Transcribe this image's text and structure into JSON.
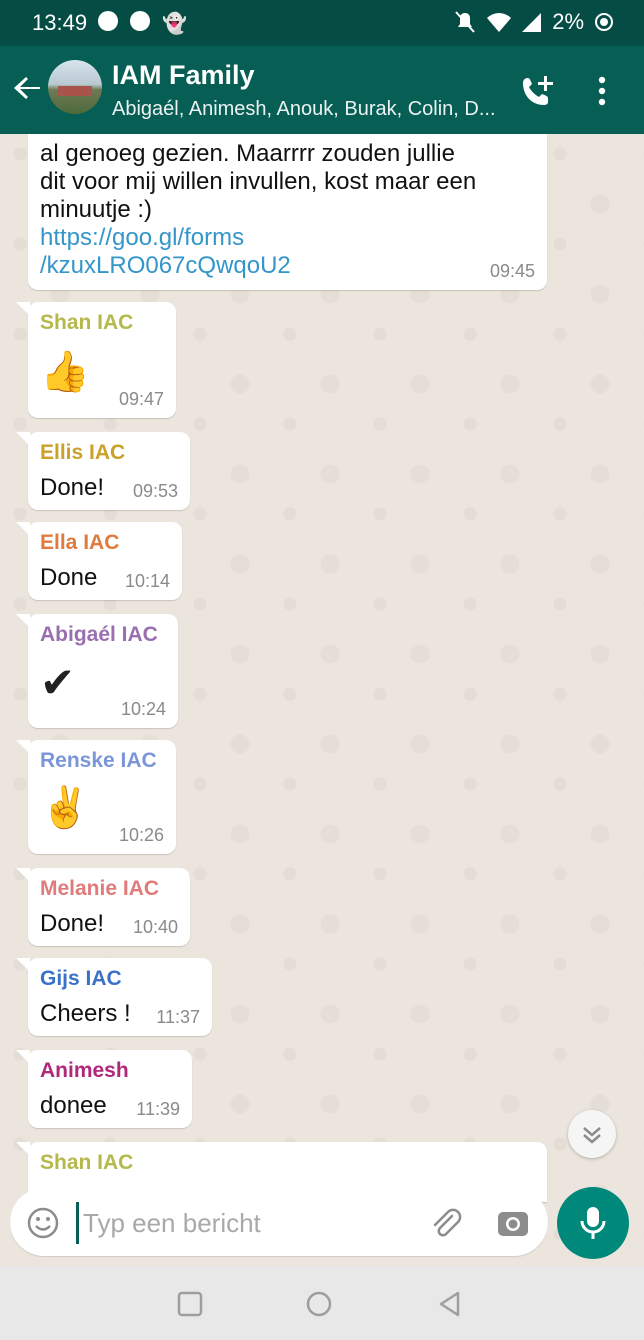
{
  "status_bar": {
    "time": "13:49",
    "battery": "2%"
  },
  "header": {
    "title": "IAM Family",
    "subtitle": "Abigaél, Animesh, Anouk, Burak, Colin, D..."
  },
  "messages": [
    {
      "lines": [
        "al genoeg gezien. Maarrrr zouden jullie",
        "dit voor mij willen invullen, kost maar een",
        "minuutje :)"
      ],
      "link_lines": [
        "https://goo.gl/forms",
        "/kzuxLRO067cQwqoU2"
      ],
      "time": "09:45"
    },
    {
      "sender": "Shan IAC",
      "sender_color": "#b5b84a",
      "text": "👍",
      "emoji": true,
      "time": "09:47"
    },
    {
      "sender": "Ellis IAC",
      "sender_color": "#c9a227",
      "text": "Done!",
      "time": "09:53"
    },
    {
      "sender": "Ella IAC",
      "sender_color": "#e07b3e",
      "text": "Done",
      "time": "10:14"
    },
    {
      "sender": "Abigaél IAC",
      "sender_color": "#9a6fb0",
      "text": "✔",
      "emoji": true,
      "time": "10:24"
    },
    {
      "sender": "Renske IAC",
      "sender_color": "#7b96d8",
      "text": "✌",
      "emoji": true,
      "time": "10:26"
    },
    {
      "sender": "Melanie IAC",
      "sender_color": "#e07b7b",
      "text": "Done!",
      "time": "10:40"
    },
    {
      "sender": "Gijs IAC",
      "sender_color": "#3b72c9",
      "text": "Cheers !",
      "time": "11:37"
    },
    {
      "sender": "Animesh",
      "sender_color": "#b0287a",
      "text": "donee",
      "time": "11:39"
    },
    {
      "sender": "Shan IAC",
      "sender_color": "#b5b84a"
    }
  ],
  "input": {
    "placeholder": "Typ een bericht"
  },
  "colors": {
    "header": "#075e54",
    "status_bar": "#054c44",
    "mic_button": "#00897b",
    "link": "#3496c9"
  },
  "icons": [
    "back-arrow-icon",
    "add-call-icon",
    "more-vert-icon",
    "emoji-icon",
    "attach-icon",
    "camera-icon",
    "mic-icon",
    "scroll-down-icon"
  ]
}
